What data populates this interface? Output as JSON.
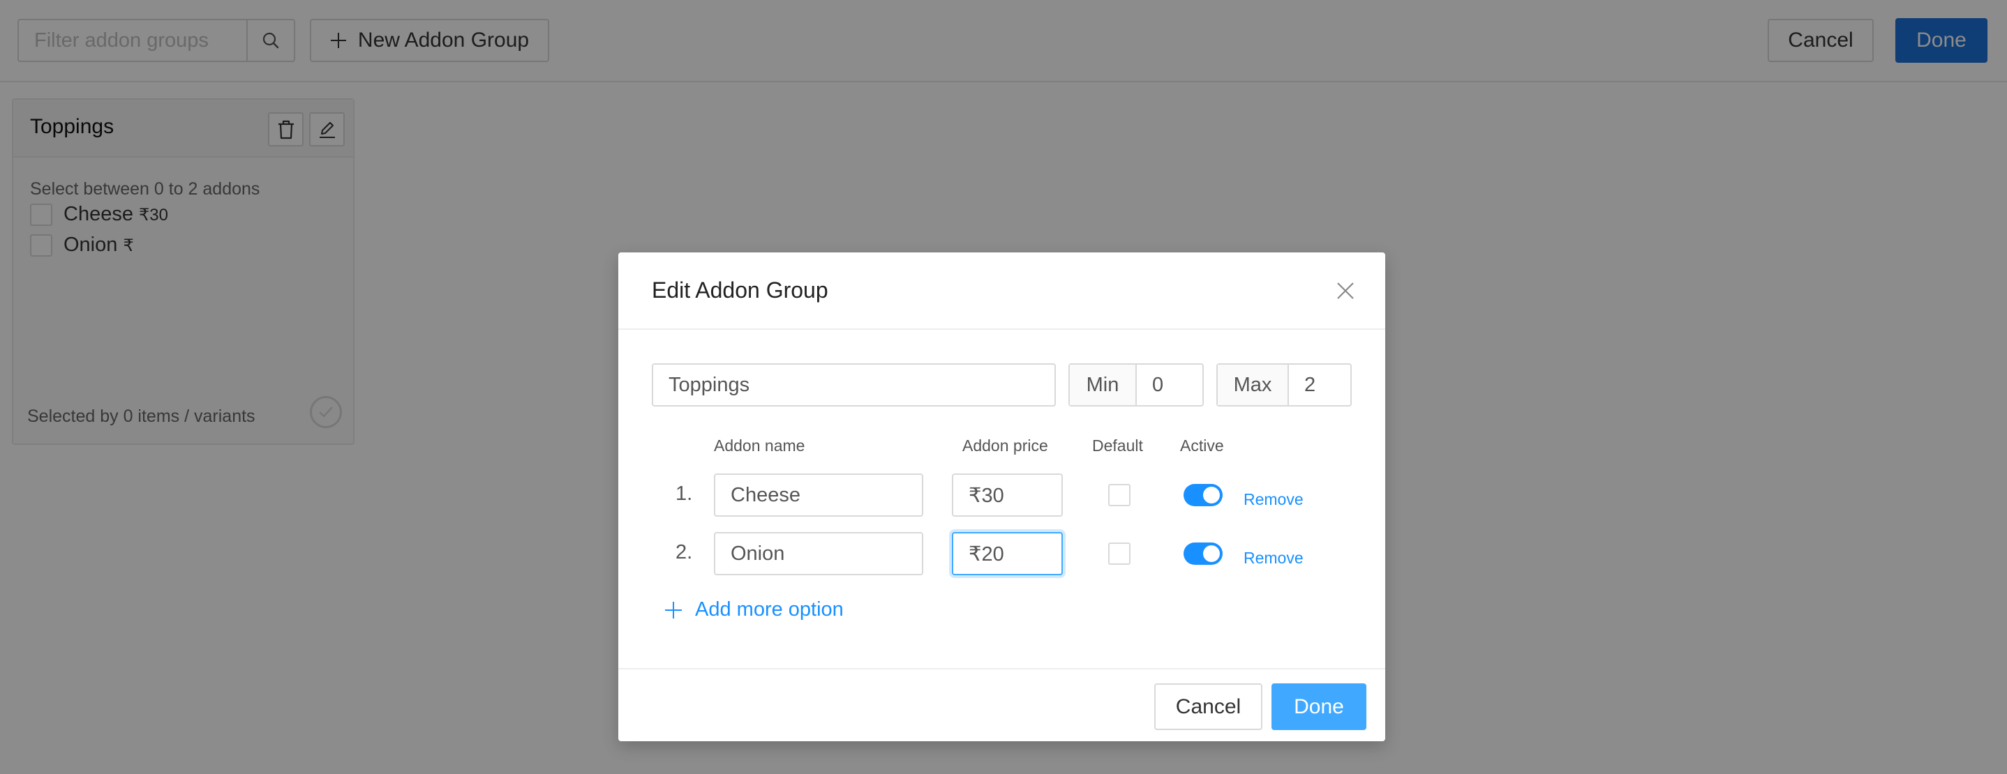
{
  "toolbar": {
    "filter_placeholder": "Filter addon groups",
    "search_icon": "search-icon",
    "new_group_label": "New Addon Group",
    "cancel_label": "Cancel",
    "done_label": "Done"
  },
  "card": {
    "title": "Toppings",
    "delete_icon": "trash-icon",
    "edit_icon": "pencil-icon",
    "subtitle": "Select between 0 to 2 addons",
    "items": [
      {
        "name": "Cheese",
        "price": "₹30"
      },
      {
        "name": "Onion",
        "price": "₹"
      }
    ],
    "footer": "Selected by 0 items / variants"
  },
  "modal": {
    "title": "Edit Addon Group",
    "group_name": "Toppings",
    "min_label": "Min",
    "min_value": "0",
    "max_label": "Max",
    "max_value": "2",
    "columns": {
      "name": "Addon name",
      "price": "Addon price",
      "default": "Default",
      "active": "Active"
    },
    "rows": [
      {
        "num": "1.",
        "name": "Cheese",
        "price": "₹30",
        "default": false,
        "active": true,
        "remove": "Remove"
      },
      {
        "num": "2.",
        "name": "Onion",
        "price": "₹20",
        "default": false,
        "active": true,
        "remove": "Remove"
      }
    ],
    "add_more_label": "Add more option",
    "cancel_label": "Cancel",
    "done_label": "Done"
  },
  "colors": {
    "primary": "#1890ff",
    "done_button": "#40a9ff",
    "top_done_button": "#1d6fd6",
    "overlay": "rgba(0,0,0,0.45)"
  }
}
